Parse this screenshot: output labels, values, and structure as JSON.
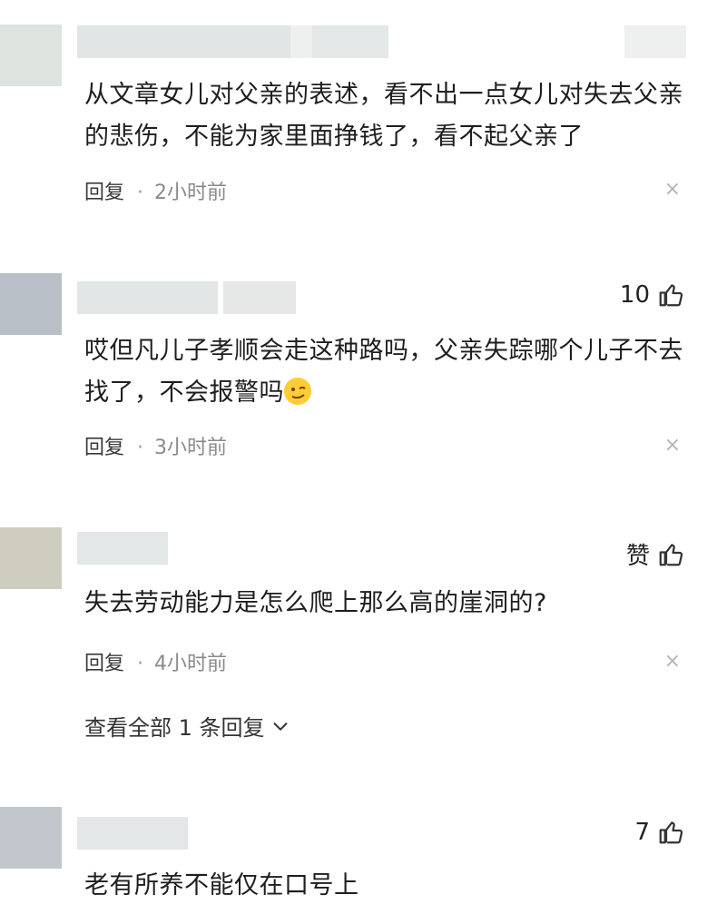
{
  "comments": [
    {
      "text": "从文章女儿对父亲的表述，看不出一点女儿对失去父亲的悲伤，不能为家里面挣钱了，看不起父亲了",
      "reply_label": "回复",
      "dot": "·",
      "time": "2小时前",
      "like_count": "",
      "avatar_color": "#dfe3e0"
    },
    {
      "text": "哎但凡儿子孝顺会走这种路吗，父亲失踪哪个儿子不去找了，不会报警吗",
      "reply_label": "回复",
      "dot": "·",
      "time": "3小时前",
      "like_count": "10",
      "avatar_color": "#b9bfc6"
    },
    {
      "text": "失去劳动能力是怎么爬上那么高的崖洞的?",
      "reply_label": "回复",
      "dot": "·",
      "time": "4小时前",
      "like_count": "赞",
      "avatar_color": "#cfcdc0"
    },
    {
      "text": "老有所养不能仅在口号上",
      "like_count": "7",
      "avatar_color": "#c2c7cd"
    }
  ],
  "view_all_replies": "查看全部 1 条回复",
  "close_symbol": "×",
  "icons": {
    "like": "thumbs-up-icon",
    "close": "close-icon",
    "expand": "chevron-down-icon",
    "emoji": "smirk-emoji-icon"
  }
}
